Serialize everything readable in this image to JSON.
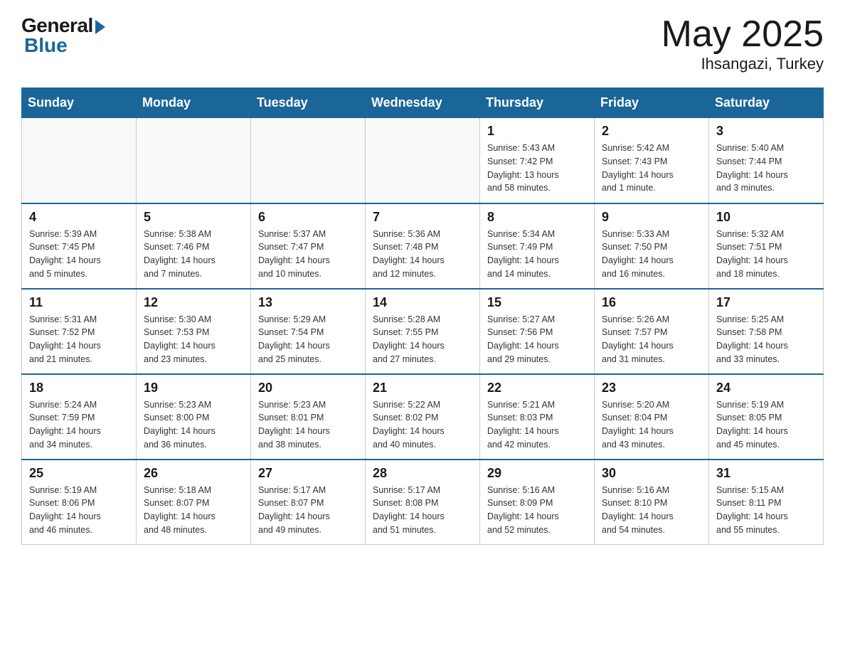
{
  "header": {
    "logo_general": "General",
    "logo_blue": "Blue",
    "month_year": "May 2025",
    "location": "Ihsangazi, Turkey"
  },
  "days_of_week": [
    "Sunday",
    "Monday",
    "Tuesday",
    "Wednesday",
    "Thursday",
    "Friday",
    "Saturday"
  ],
  "weeks": [
    [
      {
        "day": "",
        "info": ""
      },
      {
        "day": "",
        "info": ""
      },
      {
        "day": "",
        "info": ""
      },
      {
        "day": "",
        "info": ""
      },
      {
        "day": "1",
        "info": "Sunrise: 5:43 AM\nSunset: 7:42 PM\nDaylight: 13 hours\nand 58 minutes."
      },
      {
        "day": "2",
        "info": "Sunrise: 5:42 AM\nSunset: 7:43 PM\nDaylight: 14 hours\nand 1 minute."
      },
      {
        "day": "3",
        "info": "Sunrise: 5:40 AM\nSunset: 7:44 PM\nDaylight: 14 hours\nand 3 minutes."
      }
    ],
    [
      {
        "day": "4",
        "info": "Sunrise: 5:39 AM\nSunset: 7:45 PM\nDaylight: 14 hours\nand 5 minutes."
      },
      {
        "day": "5",
        "info": "Sunrise: 5:38 AM\nSunset: 7:46 PM\nDaylight: 14 hours\nand 7 minutes."
      },
      {
        "day": "6",
        "info": "Sunrise: 5:37 AM\nSunset: 7:47 PM\nDaylight: 14 hours\nand 10 minutes."
      },
      {
        "day": "7",
        "info": "Sunrise: 5:36 AM\nSunset: 7:48 PM\nDaylight: 14 hours\nand 12 minutes."
      },
      {
        "day": "8",
        "info": "Sunrise: 5:34 AM\nSunset: 7:49 PM\nDaylight: 14 hours\nand 14 minutes."
      },
      {
        "day": "9",
        "info": "Sunrise: 5:33 AM\nSunset: 7:50 PM\nDaylight: 14 hours\nand 16 minutes."
      },
      {
        "day": "10",
        "info": "Sunrise: 5:32 AM\nSunset: 7:51 PM\nDaylight: 14 hours\nand 18 minutes."
      }
    ],
    [
      {
        "day": "11",
        "info": "Sunrise: 5:31 AM\nSunset: 7:52 PM\nDaylight: 14 hours\nand 21 minutes."
      },
      {
        "day": "12",
        "info": "Sunrise: 5:30 AM\nSunset: 7:53 PM\nDaylight: 14 hours\nand 23 minutes."
      },
      {
        "day": "13",
        "info": "Sunrise: 5:29 AM\nSunset: 7:54 PM\nDaylight: 14 hours\nand 25 minutes."
      },
      {
        "day": "14",
        "info": "Sunrise: 5:28 AM\nSunset: 7:55 PM\nDaylight: 14 hours\nand 27 minutes."
      },
      {
        "day": "15",
        "info": "Sunrise: 5:27 AM\nSunset: 7:56 PM\nDaylight: 14 hours\nand 29 minutes."
      },
      {
        "day": "16",
        "info": "Sunrise: 5:26 AM\nSunset: 7:57 PM\nDaylight: 14 hours\nand 31 minutes."
      },
      {
        "day": "17",
        "info": "Sunrise: 5:25 AM\nSunset: 7:58 PM\nDaylight: 14 hours\nand 33 minutes."
      }
    ],
    [
      {
        "day": "18",
        "info": "Sunrise: 5:24 AM\nSunset: 7:59 PM\nDaylight: 14 hours\nand 34 minutes."
      },
      {
        "day": "19",
        "info": "Sunrise: 5:23 AM\nSunset: 8:00 PM\nDaylight: 14 hours\nand 36 minutes."
      },
      {
        "day": "20",
        "info": "Sunrise: 5:23 AM\nSunset: 8:01 PM\nDaylight: 14 hours\nand 38 minutes."
      },
      {
        "day": "21",
        "info": "Sunrise: 5:22 AM\nSunset: 8:02 PM\nDaylight: 14 hours\nand 40 minutes."
      },
      {
        "day": "22",
        "info": "Sunrise: 5:21 AM\nSunset: 8:03 PM\nDaylight: 14 hours\nand 42 minutes."
      },
      {
        "day": "23",
        "info": "Sunrise: 5:20 AM\nSunset: 8:04 PM\nDaylight: 14 hours\nand 43 minutes."
      },
      {
        "day": "24",
        "info": "Sunrise: 5:19 AM\nSunset: 8:05 PM\nDaylight: 14 hours\nand 45 minutes."
      }
    ],
    [
      {
        "day": "25",
        "info": "Sunrise: 5:19 AM\nSunset: 8:06 PM\nDaylight: 14 hours\nand 46 minutes."
      },
      {
        "day": "26",
        "info": "Sunrise: 5:18 AM\nSunset: 8:07 PM\nDaylight: 14 hours\nand 48 minutes."
      },
      {
        "day": "27",
        "info": "Sunrise: 5:17 AM\nSunset: 8:07 PM\nDaylight: 14 hours\nand 49 minutes."
      },
      {
        "day": "28",
        "info": "Sunrise: 5:17 AM\nSunset: 8:08 PM\nDaylight: 14 hours\nand 51 minutes."
      },
      {
        "day": "29",
        "info": "Sunrise: 5:16 AM\nSunset: 8:09 PM\nDaylight: 14 hours\nand 52 minutes."
      },
      {
        "day": "30",
        "info": "Sunrise: 5:16 AM\nSunset: 8:10 PM\nDaylight: 14 hours\nand 54 minutes."
      },
      {
        "day": "31",
        "info": "Sunrise: 5:15 AM\nSunset: 8:11 PM\nDaylight: 14 hours\nand 55 minutes."
      }
    ]
  ]
}
